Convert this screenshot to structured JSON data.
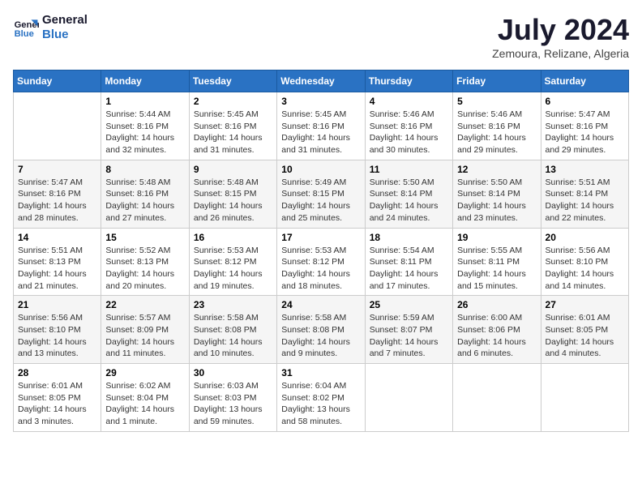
{
  "header": {
    "logo_line1": "General",
    "logo_line2": "Blue",
    "month_title": "July 2024",
    "location": "Zemoura, Relizane, Algeria"
  },
  "weekdays": [
    "Sunday",
    "Monday",
    "Tuesday",
    "Wednesday",
    "Thursday",
    "Friday",
    "Saturday"
  ],
  "weeks": [
    [
      {
        "day": "",
        "info": ""
      },
      {
        "day": "1",
        "info": "Sunrise: 5:44 AM\nSunset: 8:16 PM\nDaylight: 14 hours\nand 32 minutes."
      },
      {
        "day": "2",
        "info": "Sunrise: 5:45 AM\nSunset: 8:16 PM\nDaylight: 14 hours\nand 31 minutes."
      },
      {
        "day": "3",
        "info": "Sunrise: 5:45 AM\nSunset: 8:16 PM\nDaylight: 14 hours\nand 31 minutes."
      },
      {
        "day": "4",
        "info": "Sunrise: 5:46 AM\nSunset: 8:16 PM\nDaylight: 14 hours\nand 30 minutes."
      },
      {
        "day": "5",
        "info": "Sunrise: 5:46 AM\nSunset: 8:16 PM\nDaylight: 14 hours\nand 29 minutes."
      },
      {
        "day": "6",
        "info": "Sunrise: 5:47 AM\nSunset: 8:16 PM\nDaylight: 14 hours\nand 29 minutes."
      }
    ],
    [
      {
        "day": "7",
        "info": "Sunrise: 5:47 AM\nSunset: 8:16 PM\nDaylight: 14 hours\nand 28 minutes."
      },
      {
        "day": "8",
        "info": "Sunrise: 5:48 AM\nSunset: 8:16 PM\nDaylight: 14 hours\nand 27 minutes."
      },
      {
        "day": "9",
        "info": "Sunrise: 5:48 AM\nSunset: 8:15 PM\nDaylight: 14 hours\nand 26 minutes."
      },
      {
        "day": "10",
        "info": "Sunrise: 5:49 AM\nSunset: 8:15 PM\nDaylight: 14 hours\nand 25 minutes."
      },
      {
        "day": "11",
        "info": "Sunrise: 5:50 AM\nSunset: 8:14 PM\nDaylight: 14 hours\nand 24 minutes."
      },
      {
        "day": "12",
        "info": "Sunrise: 5:50 AM\nSunset: 8:14 PM\nDaylight: 14 hours\nand 23 minutes."
      },
      {
        "day": "13",
        "info": "Sunrise: 5:51 AM\nSunset: 8:14 PM\nDaylight: 14 hours\nand 22 minutes."
      }
    ],
    [
      {
        "day": "14",
        "info": "Sunrise: 5:51 AM\nSunset: 8:13 PM\nDaylight: 14 hours\nand 21 minutes."
      },
      {
        "day": "15",
        "info": "Sunrise: 5:52 AM\nSunset: 8:13 PM\nDaylight: 14 hours\nand 20 minutes."
      },
      {
        "day": "16",
        "info": "Sunrise: 5:53 AM\nSunset: 8:12 PM\nDaylight: 14 hours\nand 19 minutes."
      },
      {
        "day": "17",
        "info": "Sunrise: 5:53 AM\nSunset: 8:12 PM\nDaylight: 14 hours\nand 18 minutes."
      },
      {
        "day": "18",
        "info": "Sunrise: 5:54 AM\nSunset: 8:11 PM\nDaylight: 14 hours\nand 17 minutes."
      },
      {
        "day": "19",
        "info": "Sunrise: 5:55 AM\nSunset: 8:11 PM\nDaylight: 14 hours\nand 15 minutes."
      },
      {
        "day": "20",
        "info": "Sunrise: 5:56 AM\nSunset: 8:10 PM\nDaylight: 14 hours\nand 14 minutes."
      }
    ],
    [
      {
        "day": "21",
        "info": "Sunrise: 5:56 AM\nSunset: 8:10 PM\nDaylight: 14 hours\nand 13 minutes."
      },
      {
        "day": "22",
        "info": "Sunrise: 5:57 AM\nSunset: 8:09 PM\nDaylight: 14 hours\nand 11 minutes."
      },
      {
        "day": "23",
        "info": "Sunrise: 5:58 AM\nSunset: 8:08 PM\nDaylight: 14 hours\nand 10 minutes."
      },
      {
        "day": "24",
        "info": "Sunrise: 5:58 AM\nSunset: 8:08 PM\nDaylight: 14 hours\nand 9 minutes."
      },
      {
        "day": "25",
        "info": "Sunrise: 5:59 AM\nSunset: 8:07 PM\nDaylight: 14 hours\nand 7 minutes."
      },
      {
        "day": "26",
        "info": "Sunrise: 6:00 AM\nSunset: 8:06 PM\nDaylight: 14 hours\nand 6 minutes."
      },
      {
        "day": "27",
        "info": "Sunrise: 6:01 AM\nSunset: 8:05 PM\nDaylight: 14 hours\nand 4 minutes."
      }
    ],
    [
      {
        "day": "28",
        "info": "Sunrise: 6:01 AM\nSunset: 8:05 PM\nDaylight: 14 hours\nand 3 minutes."
      },
      {
        "day": "29",
        "info": "Sunrise: 6:02 AM\nSunset: 8:04 PM\nDaylight: 14 hours\nand 1 minute."
      },
      {
        "day": "30",
        "info": "Sunrise: 6:03 AM\nSunset: 8:03 PM\nDaylight: 13 hours\nand 59 minutes."
      },
      {
        "day": "31",
        "info": "Sunrise: 6:04 AM\nSunset: 8:02 PM\nDaylight: 13 hours\nand 58 minutes."
      },
      {
        "day": "",
        "info": ""
      },
      {
        "day": "",
        "info": ""
      },
      {
        "day": "",
        "info": ""
      }
    ]
  ]
}
